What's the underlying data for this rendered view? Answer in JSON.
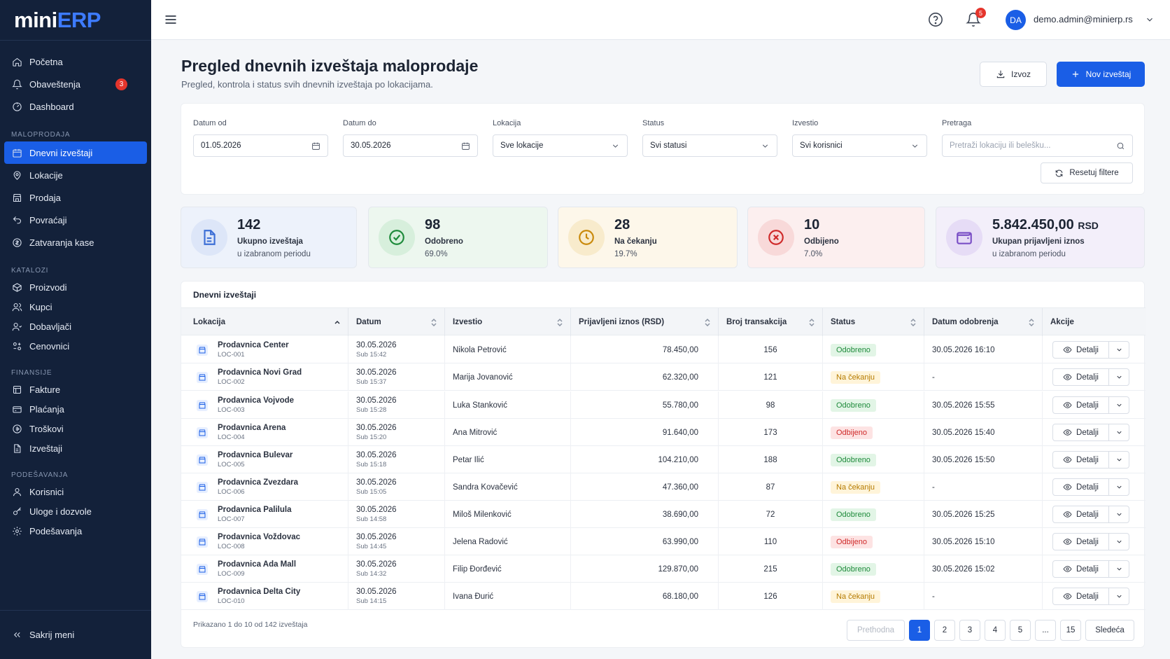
{
  "brand": {
    "part1": "mini",
    "part2": "ERP"
  },
  "nav": {
    "top": [
      {
        "label": "Početna",
        "icon": "home-icon"
      },
      {
        "label": "Obaveštenja",
        "icon": "bell-icon",
        "badge": "3"
      },
      {
        "label": "Dashboard",
        "icon": "dashboard-icon"
      }
    ],
    "sections": [
      {
        "title": "MALOPRODAJA",
        "items": [
          {
            "label": "Dnevni izveštaji",
            "icon": "calendar-icon",
            "active": true
          },
          {
            "label": "Lokacije",
            "icon": "location-icon"
          },
          {
            "label": "Prodaja",
            "icon": "store-icon"
          },
          {
            "label": "Povraćaji",
            "icon": "return-icon"
          },
          {
            "label": "Zatvaranja kase",
            "icon": "cash-icon"
          }
        ]
      },
      {
        "title": "KATALOZI",
        "items": [
          {
            "label": "Proizvodi",
            "icon": "box-icon"
          },
          {
            "label": "Kupci",
            "icon": "users-icon"
          },
          {
            "label": "Dobavljači",
            "icon": "supplier-icon"
          },
          {
            "label": "Cenovnici",
            "icon": "pricelist-icon"
          }
        ]
      },
      {
        "title": "FINANSIJE",
        "items": [
          {
            "label": "Fakture",
            "icon": "invoice-icon"
          },
          {
            "label": "Plaćanja",
            "icon": "payment-icon"
          },
          {
            "label": "Troškovi",
            "icon": "expense-icon"
          },
          {
            "label": "Izveštaji",
            "icon": "report-icon"
          }
        ]
      },
      {
        "title": "PODEŠAVANJA",
        "items": [
          {
            "label": "Korisnici",
            "icon": "user-icon"
          },
          {
            "label": "Uloge i dozvole",
            "icon": "key-icon"
          },
          {
            "label": "Podešavanja",
            "icon": "gear-icon"
          }
        ]
      }
    ],
    "collapse_label": "Sakrij meni"
  },
  "header": {
    "notifications_count": "5",
    "avatar_initials": "DA",
    "user_email": "demo.admin@minierp.rs"
  },
  "page": {
    "title": "Pregled dnevnih izveštaja maloprodaje",
    "subtitle": "Pregled, kontrola i status svih dnevnih izveštaja po lokacijama.",
    "export_label": "Izvoz",
    "new_label": "Nov izveštaj"
  },
  "filters": {
    "date_from": {
      "label": "Datum od",
      "value": "01.05.2026"
    },
    "date_to": {
      "label": "Datum do",
      "value": "30.05.2026"
    },
    "location": {
      "label": "Lokacija",
      "value": "Sve lokacije"
    },
    "status": {
      "label": "Status",
      "value": "Svi statusi"
    },
    "reporter": {
      "label": "Izvestio",
      "value": "Svi korisnici"
    },
    "search": {
      "label": "Pretraga",
      "placeholder": "Pretraži lokaciju ili belešku..."
    },
    "reset_label": "Resetuj filtere"
  },
  "stats": [
    {
      "value": "142",
      "label": "Ukupno izveštaja",
      "sub": "u izabranom periodu",
      "color": "#3d6fd6",
      "bg": "#edf2fb",
      "circle": "#dde6f8",
      "icon": "document-icon"
    },
    {
      "value": "98",
      "label": "Odobreno",
      "sub": "69.0%",
      "color": "#1d8a3a",
      "bg": "#edf7ef",
      "circle": "#d7efdc",
      "icon": "check-circle-icon"
    },
    {
      "value": "28",
      "label": "Na čekanju",
      "sub": "19.7%",
      "color": "#c9890b",
      "bg": "#fdf7ea",
      "circle": "#f8ebcc",
      "icon": "clock-icon"
    },
    {
      "value": "10",
      "label": "Odbijeno",
      "sub": "7.0%",
      "color": "#cf2a2a",
      "bg": "#fcefef",
      "circle": "#f8d9d9",
      "icon": "x-circle-icon"
    },
    {
      "value": "5.842.450,00",
      "unit": "RSD",
      "label": "Ukupan prijavljeni iznos",
      "sub": "u izabranom periodu",
      "color": "#7a4fc6",
      "bg": "#f3effa",
      "circle": "#e6dcf6",
      "icon": "wallet-icon"
    }
  ],
  "table": {
    "title": "Dnevni izveštaji",
    "columns": [
      "Lokacija",
      "Datum",
      "Izvestio",
      "Prijavljeni iznos (RSD)",
      "Broj transakcija",
      "Status",
      "Datum odobrenja",
      "Akcije"
    ],
    "rows": [
      {
        "name": "Prodavnica Center",
        "code": "LOC-001",
        "date": "30.05.2026",
        "time": "Sub 15:42",
        "reporter": "Nikola Petrović",
        "amount": "78.450,00",
        "tx": "156",
        "status": "Odobreno",
        "status_type": "ok",
        "approved": "30.05.2026 16:10"
      },
      {
        "name": "Prodavnica Novi Grad",
        "code": "LOC-002",
        "date": "30.05.2026",
        "time": "Sub 15:37",
        "reporter": "Marija Jovanović",
        "amount": "62.320,00",
        "tx": "121",
        "status": "Na čekanju",
        "status_type": "wait",
        "approved": "-"
      },
      {
        "name": "Prodavnica Vojvode",
        "code": "LOC-003",
        "date": "30.05.2026",
        "time": "Sub 15:28",
        "reporter": "Luka Stanković",
        "amount": "55.780,00",
        "tx": "98",
        "status": "Odobreno",
        "status_type": "ok",
        "approved": "30.05.2026 15:55"
      },
      {
        "name": "Prodavnica Arena",
        "code": "LOC-004",
        "date": "30.05.2026",
        "time": "Sub 15:20",
        "reporter": "Ana Mitrović",
        "amount": "91.640,00",
        "tx": "173",
        "status": "Odbijeno",
        "status_type": "no",
        "approved": "30.05.2026 15:40"
      },
      {
        "name": "Prodavnica Bulevar",
        "code": "LOC-005",
        "date": "30.05.2026",
        "time": "Sub 15:18",
        "reporter": "Petar Ilić",
        "amount": "104.210,00",
        "tx": "188",
        "status": "Odobreno",
        "status_type": "ok",
        "approved": "30.05.2026 15:50"
      },
      {
        "name": "Prodavnica Zvezdara",
        "code": "LOC-006",
        "date": "30.05.2026",
        "time": "Sub 15:05",
        "reporter": "Sandra Kovačević",
        "amount": "47.360,00",
        "tx": "87",
        "status": "Na čekanju",
        "status_type": "wait",
        "approved": "-"
      },
      {
        "name": "Prodavnica Palilula",
        "code": "LOC-007",
        "date": "30.05.2026",
        "time": "Sub 14:58",
        "reporter": "Miloš Milenković",
        "amount": "38.690,00",
        "tx": "72",
        "status": "Odobreno",
        "status_type": "ok",
        "approved": "30.05.2026 15:25"
      },
      {
        "name": "Prodavnica Voždovac",
        "code": "LOC-008",
        "date": "30.05.2026",
        "time": "Sub 14:45",
        "reporter": "Jelena Radović",
        "amount": "63.990,00",
        "tx": "110",
        "status": "Odbijeno",
        "status_type": "no",
        "approved": "30.05.2026 15:10"
      },
      {
        "name": "Prodavnica Ada Mall",
        "code": "LOC-009",
        "date": "30.05.2026",
        "time": "Sub 14:32",
        "reporter": "Filip Đorđević",
        "amount": "129.870,00",
        "tx": "215",
        "status": "Odobreno",
        "status_type": "ok",
        "approved": "30.05.2026 15:02"
      },
      {
        "name": "Prodavnica Delta City",
        "code": "LOC-010",
        "date": "30.05.2026",
        "time": "Sub 14:15",
        "reporter": "Ivana Đurić",
        "amount": "68.180,00",
        "tx": "126",
        "status": "Na čekanju",
        "status_type": "wait",
        "approved": "-"
      }
    ],
    "details_label": "Detalji",
    "summary": "Prikazano 1 do 10 od 142 izveštaja",
    "pagination": {
      "prev": "Prethodna",
      "pages": [
        "1",
        "2",
        "3",
        "4",
        "5",
        "...",
        "15"
      ],
      "current": "1",
      "next": "Sledeća"
    }
  }
}
